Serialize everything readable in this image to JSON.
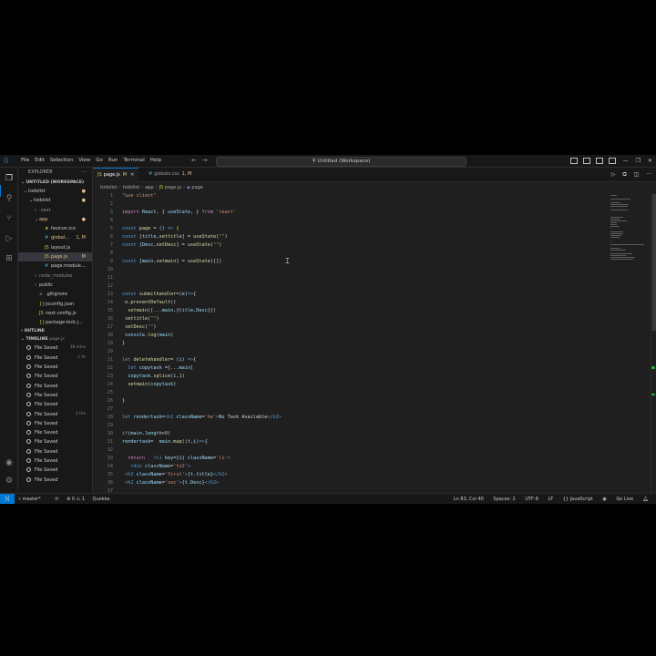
{
  "window": {
    "menu": [
      "File",
      "Edit",
      "Selection",
      "View",
      "Go",
      "Run",
      "Terminal",
      "Help"
    ],
    "search_text": "Untitled (Workspace)"
  },
  "explorer": {
    "title": "EXPLORER",
    "workspace": "UNTITLED (WORKSPACE)",
    "tree": [
      {
        "label": "todolist",
        "indent": 1,
        "chev": "⌄",
        "kind": "root",
        "dot": true
      },
      {
        "label": "todolist",
        "indent": 2,
        "chev": "⌄",
        "kind": "folder",
        "dot": true
      },
      {
        "label": ".next",
        "indent": 3,
        "chev": "›",
        "kind": "folder-grey"
      },
      {
        "label": "app",
        "indent": 3,
        "chev": "⌄",
        "kind": "folder-mod",
        "dot": true
      },
      {
        "label": "favicon.ico",
        "indent": 4,
        "chev": "",
        "kind": "ico"
      },
      {
        "label": "global...",
        "indent": 4,
        "chev": "",
        "kind": "css",
        "badge": "1, M"
      },
      {
        "label": "layout.js",
        "indent": 4,
        "chev": "",
        "kind": "js"
      },
      {
        "label": "page.js",
        "indent": 4,
        "chev": "",
        "kind": "js-mod",
        "badge": "M",
        "selected": true
      },
      {
        "label": "page.module....",
        "indent": 4,
        "chev": "",
        "kind": "css"
      },
      {
        "label": "node_modules",
        "indent": 3,
        "chev": "›",
        "kind": "folder-grey"
      },
      {
        "label": "public",
        "indent": 3,
        "chev": "›",
        "kind": "folder"
      },
      {
        "label": ".gitignore",
        "indent": 3,
        "chev": "",
        "kind": "git"
      },
      {
        "label": "jsconfig.json",
        "indent": 3,
        "chev": "",
        "kind": "json"
      },
      {
        "label": "next.config.js",
        "indent": 3,
        "chev": "",
        "kind": "js"
      },
      {
        "label": "package-lock.j...",
        "indent": 3,
        "chev": "",
        "kind": "json"
      }
    ],
    "outline_label": "OUTLINE",
    "timeline_label": "TIMELINE",
    "timeline_file": "page.js",
    "timeline": [
      {
        "label": "File Saved",
        "ago": "18 mins"
      },
      {
        "label": "File Saved",
        "ago": "1 hr"
      },
      {
        "label": "File Saved",
        "ago": ""
      },
      {
        "label": "File Saved",
        "ago": ""
      },
      {
        "label": "File Saved",
        "ago": ""
      },
      {
        "label": "File Saved",
        "ago": ""
      },
      {
        "label": "File Saved",
        "ago": ""
      },
      {
        "label": "File Saved",
        "ago": "2 hrs"
      },
      {
        "label": "File Saved",
        "ago": ""
      },
      {
        "label": "File Saved",
        "ago": ""
      },
      {
        "label": "File Saved",
        "ago": ""
      },
      {
        "label": "File Saved",
        "ago": ""
      },
      {
        "label": "File Saved",
        "ago": ""
      },
      {
        "label": "File Saved",
        "ago": ""
      },
      {
        "label": "File Saved",
        "ago": ""
      }
    ]
  },
  "tabs": [
    {
      "label": "page.js",
      "badge": "M",
      "type": "js",
      "active": true
    },
    {
      "label": "globals.css",
      "badge": "1, M",
      "type": "css",
      "active": false
    }
  ],
  "breadcrumb": [
    "todolist",
    "todolist",
    "app",
    "page.js",
    "page"
  ],
  "code_lines": [
    {
      "n": "1",
      "html": "<span class='s'>\"use client\"</span>"
    },
    {
      "n": "2",
      "html": ""
    },
    {
      "n": "3",
      "html": "<span class='k'>import</span> <span class='v'>React</span><span class='p'>, { </span><span class='v'>useState</span><span class='p'>, } </span><span class='k'>from</span> <span class='s'>'react'</span>"
    },
    {
      "n": "4",
      "html": ""
    },
    {
      "n": "5",
      "html": "<span class='b'>const</span> <span class='f'>page</span> <span class='p'>= () </span><span class='b'>=></span> <span class='y'>{</span>"
    },
    {
      "n": "6",
      "html": "<span class='b'>const</span> <span class='p'>[</span><span class='v'>title</span><span class='p'>,</span><span class='f'>settitle</span><span class='p'>] = </span><span class='f'>useState</span><span class='p'>(</span><span class='s'>\"\"</span><span class='p'>)</span>"
    },
    {
      "n": "7",
      "html": "<span class='b'>const</span> <span class='p'>[</span><span class='v'>Desc</span><span class='p'>,</span><span class='f'>setDesc</span><span class='p'>] = </span><span class='f'>useState</span><span class='p'>(</span><span class='s'>\"\"</span><span class='p'>)</span>"
    },
    {
      "n": "8",
      "html": ""
    },
    {
      "n": "9",
      "html": "<span class='b'>const</span> <span class='p'>[</span><span class='v'>main</span><span class='p'>,</span><span class='f'>setmain</span><span class='p'>] = </span><span class='f'>useState</span><span class='p'>([])</span>"
    },
    {
      "n": "10",
      "html": ""
    },
    {
      "n": "11",
      "html": ""
    },
    {
      "n": "12",
      "html": ""
    },
    {
      "n": "13",
      "html": "<span class='b'>const</span> <span class='f'>submithandler</span><span class='p'>=(</span><span class='v'>e</span><span class='p'>)</span><span class='b'>=></span><span class='p'>{</span>"
    },
    {
      "n": "14",
      "html": " <span class='v'>e</span><span class='p'>.</span><span class='f'>preventDefault</span><span class='p'>()</span>"
    },
    {
      "n": "15",
      "html": "  <span class='f'>setmain</span><span class='p'>([...</span><span class='v'>main</span><span class='p'>,{</span><span class='v'>title</span><span class='p'>,</span><span class='v'>Desc</span><span class='p'>}])</span>"
    },
    {
      "n": "16",
      "html": " <span class='f'>settitle</span><span class='p'>(</span><span class='s'>\"\"</span><span class='p'>)</span>"
    },
    {
      "n": "17",
      "html": " <span class='f'>setDesc</span><span class='p'>(</span><span class='s'>\"\"</span><span class='p'>)</span>"
    },
    {
      "n": "18",
      "html": " <span class='v'>console</span><span class='p'>.</span><span class='f'>log</span><span class='p'>(</span><span class='v'>main</span><span class='p'>)</span>"
    },
    {
      "n": "19",
      "html": "<span class='p'>}</span>"
    },
    {
      "n": "20",
      "html": ""
    },
    {
      "n": "21",
      "html": "<span class='b'>let</span> <span class='f'>deletehandler</span><span class='p'>= (</span><span class='v'>i</span><span class='p'>) </span><span class='b'>=></span><span class='p'>{</span>"
    },
    {
      "n": "22",
      "html": "  <span class='b'>let</span> <span class='v'>copytask</span> <span class='p'>=[...</span><span class='v'>main</span><span class='p'>]</span>"
    },
    {
      "n": "23",
      "html": "  <span class='v'>copytask</span><span class='p'>.</span><span class='f'>splice</span><span class='p'>(</span><span class='v'>i</span><span class='p'>,</span><span class='n'>1</span><span class='p'>)</span>"
    },
    {
      "n": "24",
      "html": "  <span class='f'>setmain</span><span class='p'>(</span><span class='v'>copytask</span><span class='p'>)</span>"
    },
    {
      "n": "25",
      "html": ""
    },
    {
      "n": "26",
      "html": "<span class='p'>}</span>"
    },
    {
      "n": "27",
      "html": ""
    },
    {
      "n": "28",
      "html": "<span class='b'>let</span> <span class='v'>rendertask</span><span class='p'>=</span><span class='tg'>&lt;h2</span> <span class='at'>className</span><span class='p'>=</span><span class='s'>'he'</span><span class='tg'>&gt;</span><span class='tx'>No Task Available</span><span class='tg'>&lt;/h2&gt;</span>"
    },
    {
      "n": "29",
      "html": ""
    },
    {
      "n": "30",
      "html": "<span class='k'>if</span><span class='p'>(</span><span class='v'>main</span><span class='p'>.</span><span class='v'>length</span><span class='p'>&gt;</span><span class='n'>0</span><span class='p'>)</span>"
    },
    {
      "n": "31",
      "html": "<span class='v'>rendertask</span><span class='p'>=  </span><span class='v'>main</span><span class='p'>.</span><span class='f'>map</span><span class='p'>((</span><span class='v'>t</span><span class='p'>,</span><span class='v'>i</span><span class='p'>)</span><span class='b'>=></span><span class='p'>{</span>"
    },
    {
      "n": "32",
      "html": ""
    },
    {
      "n": "33",
      "html": "  <span class='k'>return</span>   <span class='tg'>&lt;li</span> <span class='at'>key</span><span class='p'>={</span><span class='v'>i</span><span class='p'>}</span> <span class='at'>className</span><span class='p'>=</span><span class='s'>'li'</span><span class='tg'>&gt;</span>"
    },
    {
      "n": "34",
      "html": "   <span class='tg'>&lt;div</span> <span class='at'>className</span><span class='p'>=</span><span class='s'>'tz2'</span><span class='tg'>&gt;</span>"
    },
    {
      "n": "35",
      "html": " <span class='tg'>&lt;h2</span> <span class='at'>className</span><span class='p'>=</span><span class='s'>'first'</span><span class='tg'>&gt;</span><span class='p'>{</span><span class='v'>t</span><span class='p'>.</span><span class='v'>title</span><span class='p'>}</span><span class='tg'>&lt;/h2&gt;</span>"
    },
    {
      "n": "36",
      "html": " <span class='tg'>&lt;h2</span> <span class='at'>className</span><span class='p'>=</span><span class='s'>'sec'</span><span class='tg'>&gt;</span><span class='p'>{</span><span class='v'>t</span><span class='p'>.</span><span class='v'>Desc</span><span class='p'>}</span><span class='tg'>&lt;/h2&gt;</span>"
    },
    {
      "n": "37",
      "html": ""
    }
  ],
  "statusbar": {
    "branch": "master*",
    "sync": "⟳",
    "problems": "⊗ 0 ⚠ 1",
    "quokka": "Quokka",
    "position": "Ln 83, Col 40",
    "spaces": "Spaces: 2",
    "encoding": "UTF-8",
    "eol": "LF",
    "language": "{} JavaScript",
    "golive": "Go Live"
  }
}
